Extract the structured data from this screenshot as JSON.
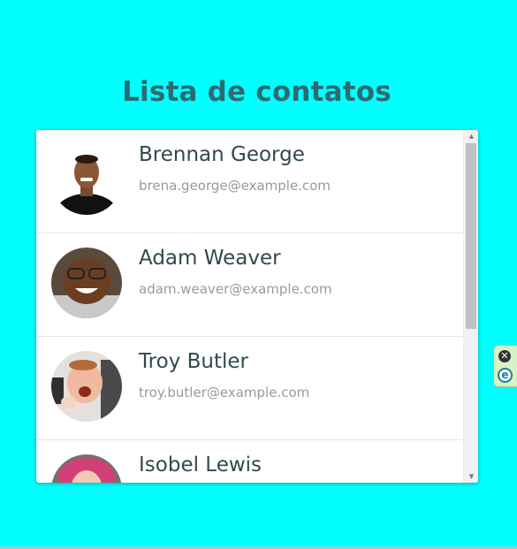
{
  "page": {
    "title": "Lista de contatos"
  },
  "contacts": [
    {
      "name": "Brennan George",
      "email": "brena.george@example.com"
    },
    {
      "name": "Adam Weaver",
      "email": "adam.weaver@example.com"
    },
    {
      "name": "Troy Butler",
      "email": "troy.butler@example.com"
    },
    {
      "name": "Isobel Lewis",
      "email": ""
    }
  ],
  "scrollbar": {
    "up_glyph": "▲",
    "down_glyph": "▼"
  },
  "extension_widget": {
    "close_glyph": "✕",
    "logo_glyph": "e"
  },
  "colors": {
    "background": "#00ffff",
    "title": "#2c6b70",
    "name_text": "#2f4a4d",
    "email_text": "#9a9a9a"
  }
}
